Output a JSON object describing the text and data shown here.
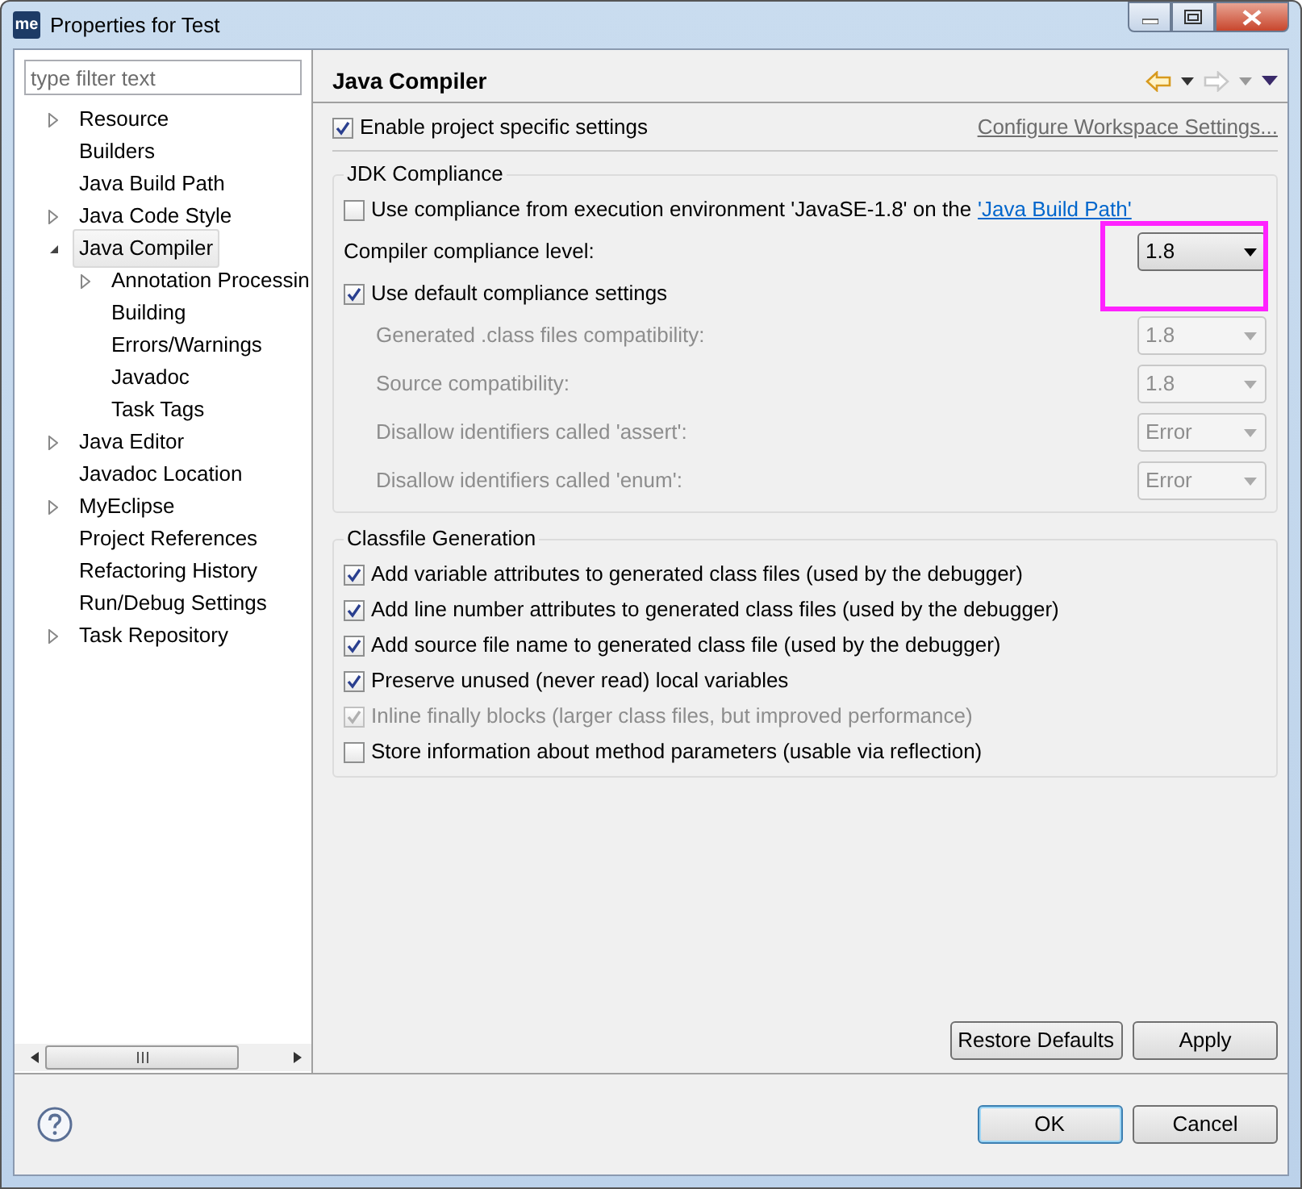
{
  "window": {
    "title": "Properties for Test",
    "logo_text": "me"
  },
  "filter": {
    "placeholder": "type filter text"
  },
  "tree": [
    {
      "label": "Resource",
      "expandable": true,
      "expanded": false,
      "selected": false
    },
    {
      "label": "Builders",
      "expandable": false,
      "selected": false
    },
    {
      "label": "Java Build Path",
      "expandable": false,
      "selected": false
    },
    {
      "label": "Java Code Style",
      "expandable": true,
      "expanded": false,
      "selected": false
    },
    {
      "label": "Java Compiler",
      "expandable": true,
      "expanded": true,
      "selected": true,
      "children": [
        {
          "label": "Annotation Processin",
          "expandable": true,
          "expanded": false,
          "selected": false
        },
        {
          "label": "Building",
          "expandable": false,
          "selected": false
        },
        {
          "label": "Errors/Warnings",
          "expandable": false,
          "selected": false
        },
        {
          "label": "Javadoc",
          "expandable": false,
          "selected": false
        },
        {
          "label": "Task Tags",
          "expandable": false,
          "selected": false
        }
      ]
    },
    {
      "label": "Java Editor",
      "expandable": true,
      "expanded": false,
      "selected": false
    },
    {
      "label": "Javadoc Location",
      "expandable": false,
      "selected": false
    },
    {
      "label": "MyEclipse",
      "expandable": true,
      "expanded": false,
      "selected": false
    },
    {
      "label": "Project References",
      "expandable": false,
      "selected": false
    },
    {
      "label": "Refactoring History",
      "expandable": false,
      "selected": false
    },
    {
      "label": "Run/Debug Settings",
      "expandable": false,
      "selected": false
    },
    {
      "label": "Task Repository",
      "expandable": true,
      "expanded": false,
      "selected": false
    }
  ],
  "page": {
    "title": "Java Compiler",
    "history": [
      {
        "kind": "back",
        "disabled": false
      },
      {
        "kind": "forward",
        "disabled": true
      }
    ],
    "enable": {
      "label": "Enable project specific settings",
      "checked": true
    },
    "configure_link": "Configure Workspace Settings...",
    "groups": [
      {
        "title": "JDK Compliance",
        "rows": [
          {
            "kind": "checkbox",
            "label": "Use compliance from execution environment 'JavaSE-1.8' on the",
            "link": "'Java Build Path'",
            "checked": false,
            "disabled": false
          },
          {
            "kind": "combo",
            "label": "Compiler compliance level:",
            "value": "1.8",
            "disabled": false,
            "highlighted": true
          },
          {
            "kind": "checkbox",
            "label": "Use default compliance settings",
            "checked": true,
            "disabled": false,
            "children": [
              {
                "kind": "combo",
                "label": "Generated .class files compatibility:",
                "value": "1.8",
                "disabled": true
              },
              {
                "kind": "combo",
                "label": "Source compatibility:",
                "value": "1.8",
                "disabled": true
              },
              {
                "kind": "combo",
                "label": "Disallow identifiers called 'assert':",
                "value": "Error",
                "disabled": true
              },
              {
                "kind": "combo",
                "label": "Disallow identifiers called 'enum':",
                "value": "Error",
                "disabled": true
              }
            ]
          }
        ]
      },
      {
        "title": "Classfile Generation",
        "rows": [
          {
            "kind": "checkbox",
            "label": "Add variable attributes to generated class files (used by the debugger)",
            "checked": true,
            "disabled": false
          },
          {
            "kind": "checkbox",
            "label": "Add line number attributes to generated class files (used by the debugger)",
            "checked": true,
            "disabled": false
          },
          {
            "kind": "checkbox",
            "label": "Add source file name to generated class file (used by the debugger)",
            "checked": true,
            "disabled": false
          },
          {
            "kind": "checkbox",
            "label": "Preserve unused (never read) local variables",
            "checked": true,
            "disabled": false
          },
          {
            "kind": "checkbox",
            "label": "Inline finally blocks (larger class files, but improved performance)",
            "checked": true,
            "disabled": true
          },
          {
            "kind": "checkbox",
            "label": "Store information about method parameters (usable via reflection)",
            "checked": false,
            "disabled": false
          }
        ]
      }
    ],
    "page_buttons": [
      "Restore Defaults",
      "Apply"
    ]
  },
  "dialog_buttons": [
    {
      "label": "OK",
      "default": true
    },
    {
      "label": "Cancel",
      "default": false
    }
  ]
}
